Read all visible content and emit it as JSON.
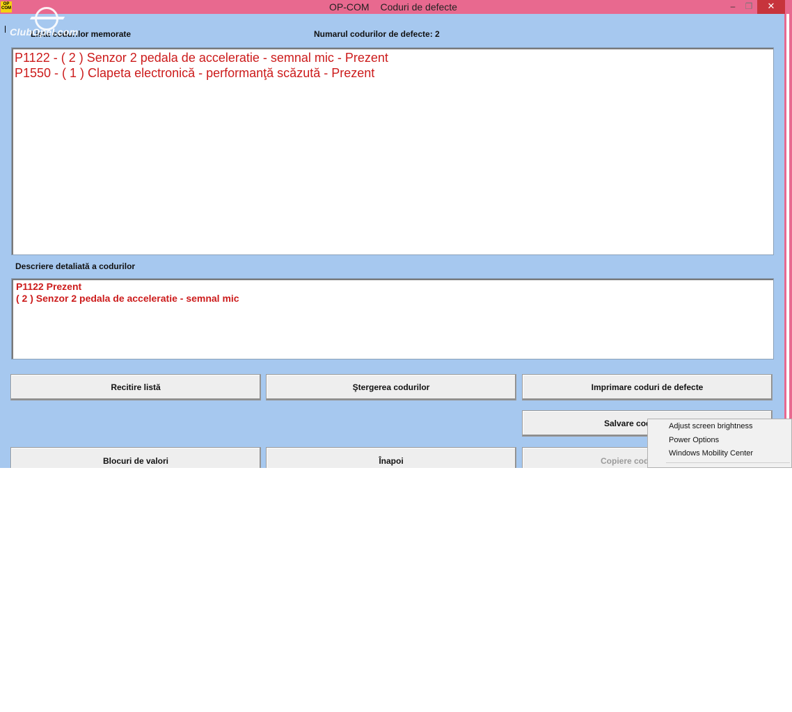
{
  "window": {
    "app_icon_text": "OP COM",
    "title_app": "OP-COM",
    "title_page": "Coduri de defecte",
    "minimize_glyph": "–",
    "maximize_glyph": "❐",
    "close_glyph": "✕",
    "titlebar_color": "#e8698f",
    "background_color": "#a6c8ef"
  },
  "watermark": {
    "text": "ClubOpel.com"
  },
  "header": {
    "codes_label": "Lista codurilor memorate",
    "count_label": "Numarul codurilor de defecte: 2"
  },
  "codes": [
    "P1122 - ( 2 )  Senzor 2 pedala de acceleratie - semnal mic - Prezent",
    "P1550 - ( 1 )  Clapeta electronică - performanţă scăzută - Prezent"
  ],
  "details": {
    "label": "Descriere detaliată a codurilor",
    "lines": [
      "P1122  Prezent",
      "( 2 )  Senzor 2 pedala de acceleratie - semnal mic"
    ],
    "text_color": "#cc1b1b"
  },
  "buttons": {
    "reread": "Recitire listă",
    "delete": "Ştergerea codurilor",
    "print": "Imprimare coduri de defecte",
    "save": "Salvare cod",
    "blocks": "Blocuri de valori",
    "back": "Înapoi",
    "copy": "Copiere cod"
  },
  "context_menu": {
    "items": [
      "Adjust screen brightness",
      "Power Options",
      "Windows Mobility Center"
    ]
  }
}
